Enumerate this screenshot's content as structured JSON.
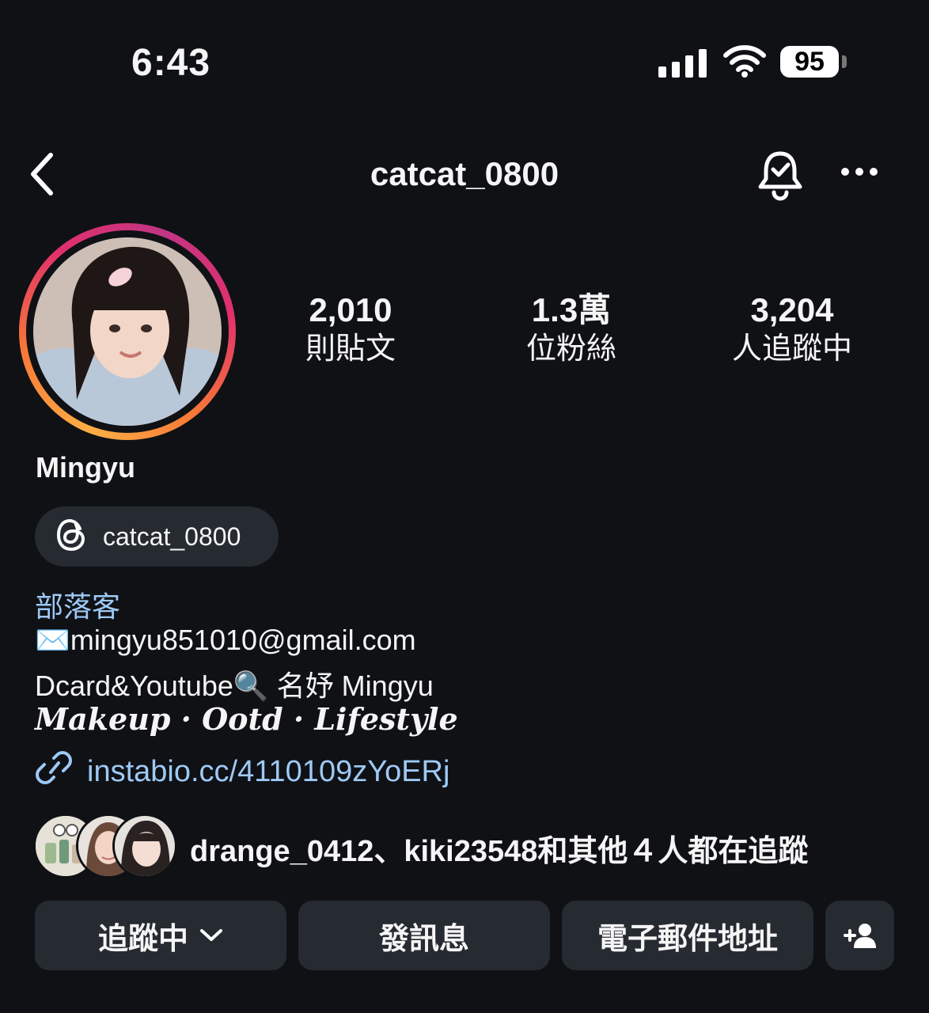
{
  "status_bar": {
    "time": "6:43",
    "battery": "95"
  },
  "header": {
    "username": "catcat_0800"
  },
  "stats": [
    {
      "value": "2,010",
      "label": "則貼文"
    },
    {
      "value": "1.3萬",
      "label": "位粉絲"
    },
    {
      "value": "3,204",
      "label": "人追蹤中"
    }
  ],
  "profile": {
    "name": "Mingyu",
    "threads_handle": "catcat_0800",
    "category": "部落客",
    "bio": [
      "✉️mingyu851010@gmail.com",
      "Dcard&Youtube🔍 名妤 Mingyu",
      "Makeup · Ootd · Lifestyle"
    ],
    "link": "instabio.cc/4110109zYoERj"
  },
  "followed_by": "drange_0412、kiki23548和其他４人都在追蹤",
  "buttons": {
    "following": "追蹤中",
    "message": "發訊息",
    "email": "電子郵件地址"
  }
}
